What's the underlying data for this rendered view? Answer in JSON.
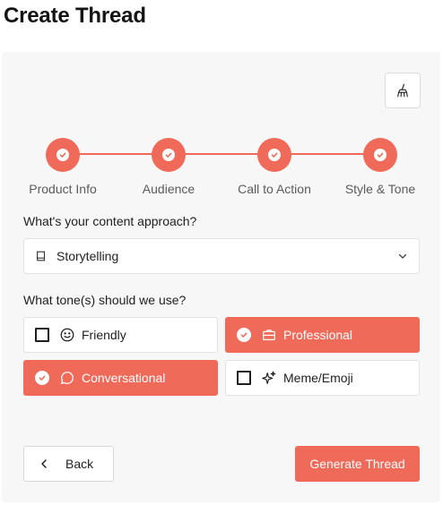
{
  "page": {
    "title": "Create Thread"
  },
  "toolbar": {
    "clear_icon": "brush-icon"
  },
  "stepper": {
    "steps": [
      {
        "label": "Product Info",
        "status": "complete"
      },
      {
        "label": "Audience",
        "status": "complete"
      },
      {
        "label": "Call to Action",
        "status": "complete"
      },
      {
        "label": "Style & Tone",
        "status": "complete"
      }
    ]
  },
  "approach": {
    "question": "What's your content approach?",
    "selected": "Storytelling",
    "icon": "book-icon"
  },
  "tone": {
    "question": "What tone(s) should we use?",
    "options": [
      {
        "label": "Friendly",
        "icon": "smile-icon",
        "selected": false
      },
      {
        "label": "Professional",
        "icon": "briefcase-icon",
        "selected": true
      },
      {
        "label": "Conversational",
        "icon": "chat-bubble-icon",
        "selected": true
      },
      {
        "label": "Meme/Emoji",
        "icon": "sparkle-icon",
        "selected": false
      }
    ]
  },
  "actions": {
    "back_label": "Back",
    "generate_label": "Generate Thread"
  },
  "colors": {
    "accent": "#f06a5a",
    "card_bg": "#f7f7f7",
    "border": "#e2e2e2"
  }
}
